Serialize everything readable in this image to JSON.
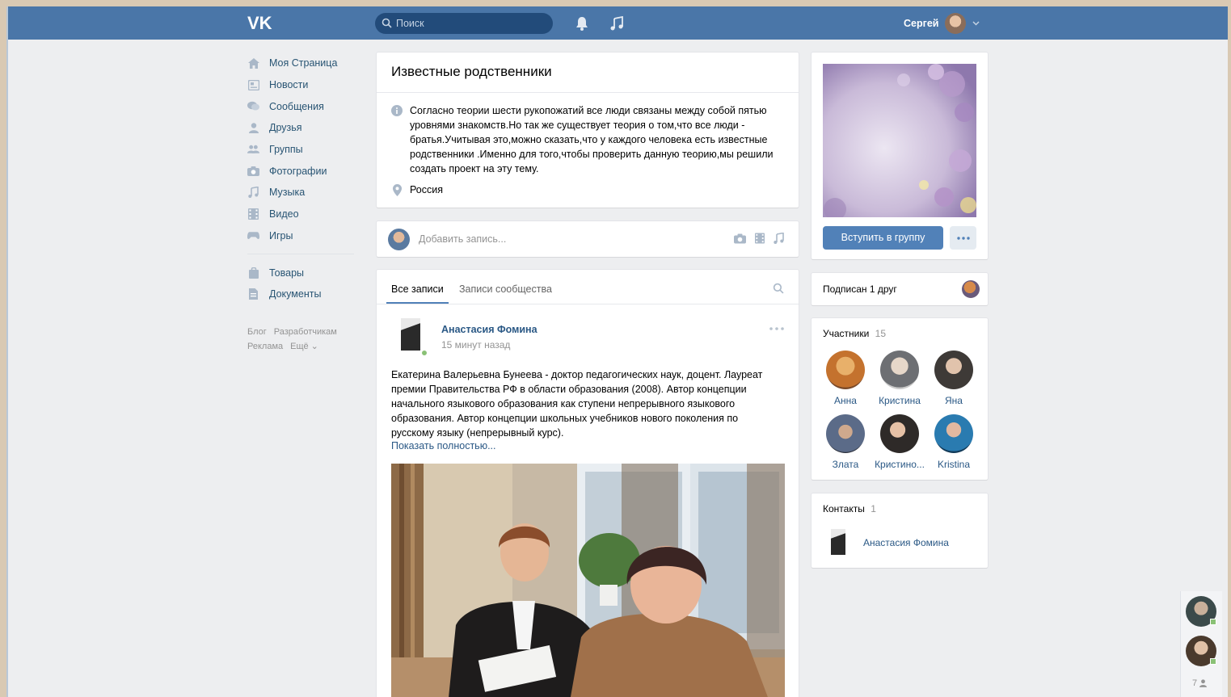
{
  "header": {
    "logo": "VK",
    "search_placeholder": "Поиск",
    "user_name": "Сергей"
  },
  "left_menu": {
    "items": [
      {
        "label": "Моя Страница",
        "icon": "home-icon"
      },
      {
        "label": "Новости",
        "icon": "news-icon"
      },
      {
        "label": "Сообщения",
        "icon": "messages-icon"
      },
      {
        "label": "Друзья",
        "icon": "friend-icon"
      },
      {
        "label": "Группы",
        "icon": "groups-icon"
      },
      {
        "label": "Фотографии",
        "icon": "camera-icon"
      },
      {
        "label": "Музыка",
        "icon": "music-icon"
      },
      {
        "label": "Видео",
        "icon": "video-icon"
      },
      {
        "label": "Игры",
        "icon": "gamepad-icon"
      }
    ],
    "items2": [
      {
        "label": "Товары",
        "icon": "bag-icon"
      },
      {
        "label": "Документы",
        "icon": "document-icon"
      }
    ],
    "footer": {
      "blog": "Блог",
      "developers": "Разработчикам",
      "ads": "Реклама",
      "more": "Ещё ⌄"
    }
  },
  "group": {
    "title": "Известные родственники",
    "description": "Согласно теории шести рукопожатий все люди связаны между собой пятью уровнями знакомств.Но так же существует теория о том,что все люди - братья.Учитывая это,можно сказать,что у каждого человека есть известные родственники .Именно для того,чтобы проверить данную теорию,мы решили создать проект на эту тему.",
    "location": "Россия"
  },
  "composer": {
    "placeholder": "Добавить запись..."
  },
  "tabs": {
    "all": "Все записи",
    "community": "Записи сообщества"
  },
  "post": {
    "author": "Анастасия Фомина",
    "time": "15 минут назад",
    "text": "Екатерина Валерьевна Бунеева - доктор педагогических наук, доцент. Лауреат премии Правительства РФ в области образования (2008). Автор концепции начального языкового образования как ступени непрерывного языкового образования. Автор концепции школьных учебников нового поколения по русскому языку (непрерывный курс).",
    "show_more": "Показать полностью..."
  },
  "right": {
    "join_button": "Вступить в группу",
    "subscribed": "Подписан 1 друг",
    "members_label": "Участники",
    "members_count": "15",
    "members": [
      {
        "name": "Анна",
        "color": "#c4722e"
      },
      {
        "name": "Кристина",
        "color": "#6d6f73"
      },
      {
        "name": "Яна",
        "color": "#3e3a37"
      },
      {
        "name": "Злата",
        "color": "#5b6b88"
      },
      {
        "name": "Кристино...",
        "color": "#2e2a28"
      },
      {
        "name": "Kristina",
        "color": "#2a7bb0"
      }
    ],
    "contacts_label": "Контакты",
    "contacts_count": "1",
    "contact_name": "Анастасия Фомина"
  },
  "chat": {
    "online_count": "7"
  },
  "colors": {
    "header": "#4a76a8",
    "accent": "#5181b8",
    "link": "#2a5885",
    "page_bg": "#edeef0"
  }
}
